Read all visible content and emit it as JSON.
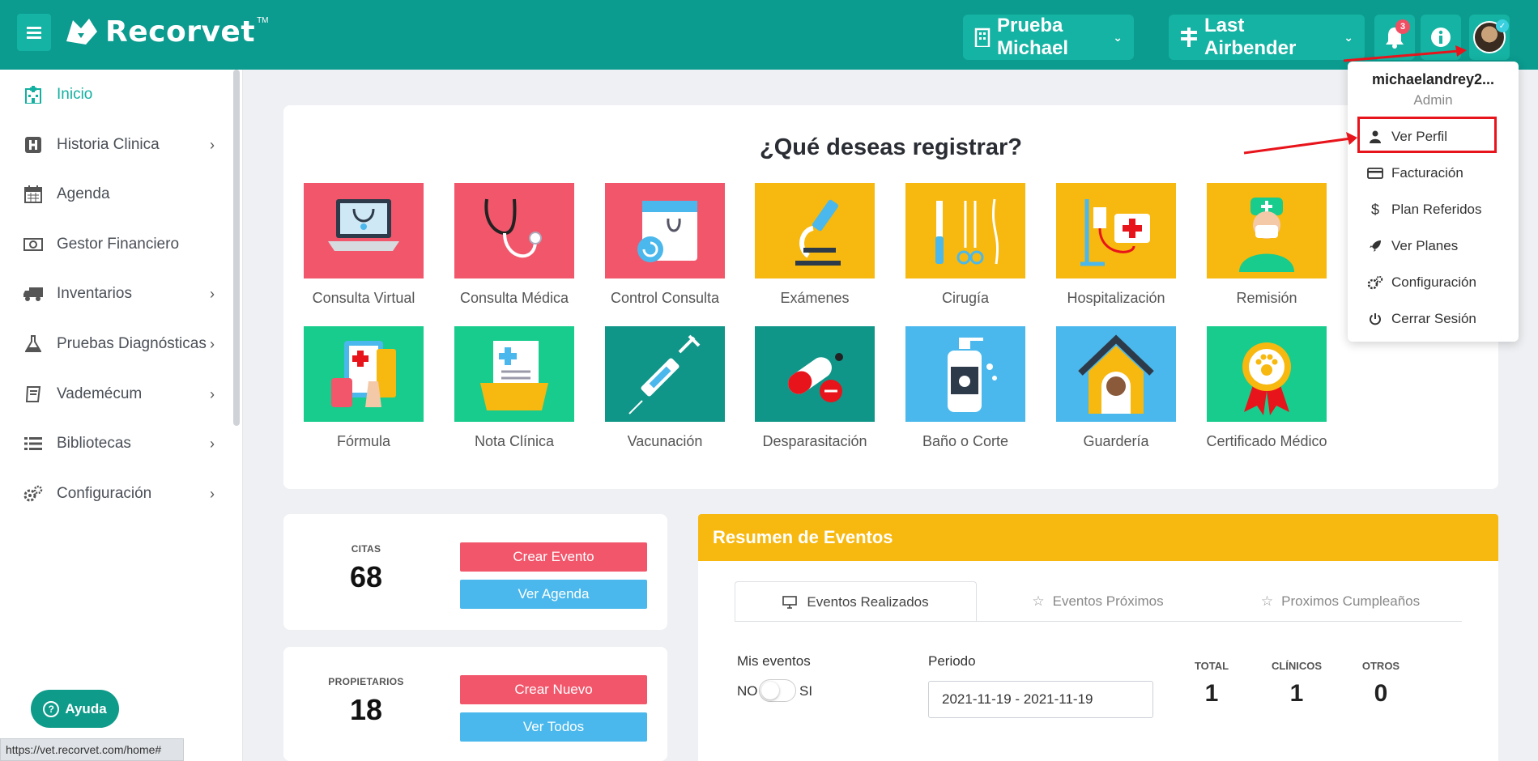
{
  "app": {
    "logo_text": "Recorvet",
    "logo_tm": "TM"
  },
  "topbar": {
    "clinic": "Prueba Michael",
    "branch": "Last Airbender",
    "notifications_count": "3",
    "colors": {
      "bar": "#0b9b8f",
      "pill": "#15b3a3"
    }
  },
  "sidebar": {
    "items": [
      {
        "label": "Inicio",
        "icon": "hospital-icon"
      },
      {
        "label": "Historia Clinica",
        "icon": "h-square-icon"
      },
      {
        "label": "Agenda",
        "icon": "calendar-icon"
      },
      {
        "label": "Gestor Financiero",
        "icon": "money-icon"
      },
      {
        "label": "Inventarios",
        "icon": "truck-icon"
      },
      {
        "label": "Pruebas Diagnósticas",
        "icon": "flask-icon"
      },
      {
        "label": "Vademécum",
        "icon": "book-icon"
      },
      {
        "label": "Bibliotecas",
        "icon": "list-icon"
      },
      {
        "label": "Configuración",
        "icon": "cogs-icon"
      }
    ],
    "help_label": "Ayuda",
    "help_icon_glyph": "?"
  },
  "status_url": "https://vet.recorvet.com/home#",
  "register": {
    "title": "¿Qué deseas registrar?",
    "tiles": [
      {
        "label": "Consulta Virtual",
        "color": "#f2566b"
      },
      {
        "label": "Consulta Médica",
        "color": "#f2566b"
      },
      {
        "label": "Control Consulta",
        "color": "#f2566b"
      },
      {
        "label": "Exámenes",
        "color": "#f7b80f"
      },
      {
        "label": "Cirugía",
        "color": "#f7b80f"
      },
      {
        "label": "Hospitalización",
        "color": "#f7b80f"
      },
      {
        "label": "Remisión",
        "color": "#f7b80f"
      },
      {
        "label": "Fórmula",
        "color": "#17cc8c"
      },
      {
        "label": "Nota Clínica",
        "color": "#17cc8c"
      },
      {
        "label": "Vacunación",
        "color": "#0f9688"
      },
      {
        "label": "Desparasitación",
        "color": "#0f9688"
      },
      {
        "label": "Baño o Corte",
        "color": "#4ab8ec"
      },
      {
        "label": "Guardería",
        "color": "#4ab8ec"
      },
      {
        "label": "Certificado Médico",
        "color": "#17cc8c"
      }
    ]
  },
  "stats": {
    "citas": {
      "label": "CITAS",
      "value": "68",
      "btn1": "Crear Evento",
      "btn2": "Ver Agenda"
    },
    "propietarios": {
      "label": "PROPIETARIOS",
      "value": "18",
      "btn1": "Crear Nuevo",
      "btn2": "Ver Todos"
    }
  },
  "events": {
    "title": "Resumen de Eventos",
    "tabs": [
      "Eventos Realizados",
      "Eventos Próximos",
      "Proximos Cumpleaños"
    ],
    "mis_eventos_label": "Mis eventos",
    "toggle_no": "NO",
    "toggle_si": "SI",
    "periodo_label": "Periodo",
    "periodo_value": "2021-11-19 - 2021-11-19",
    "counters": [
      {
        "label": "TOTAL",
        "value": "1"
      },
      {
        "label": "CLÍNICOS",
        "value": "1"
      },
      {
        "label": "OTROS",
        "value": "0"
      }
    ]
  },
  "user_menu": {
    "username": "michaelandrey2...",
    "role": "Admin",
    "items": [
      {
        "label": "Ver Perfil",
        "icon": "user-md-icon"
      },
      {
        "label": "Facturación",
        "icon": "credit-card-icon"
      },
      {
        "label": "Plan Referidos",
        "icon": "dollar-icon"
      },
      {
        "label": "Ver Planes",
        "icon": "rocket-icon"
      },
      {
        "label": "Configuración",
        "icon": "cogs-icon"
      },
      {
        "label": "Cerrar Sesión",
        "icon": "power-icon"
      }
    ]
  }
}
